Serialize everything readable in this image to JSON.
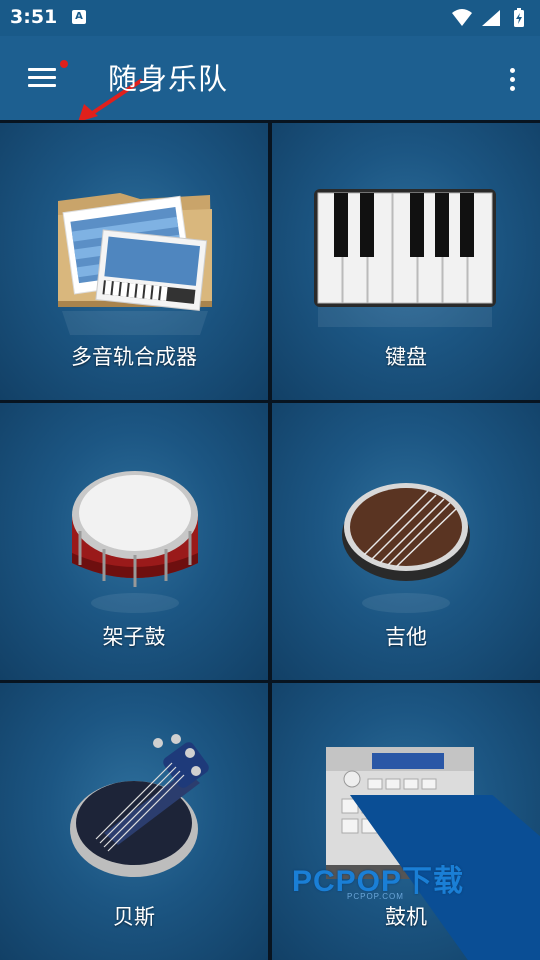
{
  "status_bar": {
    "time": "3:51",
    "notification_icon": "A"
  },
  "app_bar": {
    "title": "随身乐队"
  },
  "tiles": [
    {
      "label": "多音轨合成器",
      "icon": "multitrack-synth-icon"
    },
    {
      "label": "键盘",
      "icon": "keyboard-icon"
    },
    {
      "label": "架子鼓",
      "icon": "drum-icon"
    },
    {
      "label": "吉他",
      "icon": "guitar-icon"
    },
    {
      "label": "贝斯",
      "icon": "bass-icon"
    },
    {
      "label": "鼓机",
      "icon": "drum-machine-icon"
    }
  ],
  "watermark": {
    "text": "PCPOP下载",
    "sub": "PCPOP.COM"
  },
  "colors": {
    "app_bar": "#1d5f90",
    "status_bar": "#195a89",
    "tile": "#1c5683",
    "grid_line": "#081420"
  }
}
